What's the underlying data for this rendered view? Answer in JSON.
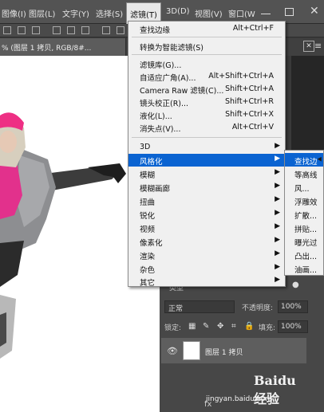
{
  "menubar": {
    "items": [
      {
        "label": "图像(I)",
        "active": false
      },
      {
        "label": "图层(L)",
        "active": false
      },
      {
        "label": "文字(Y)",
        "active": false
      },
      {
        "label": "选择(S)",
        "active": false
      },
      {
        "label": "滤镜(T)",
        "active": true
      },
      {
        "label": "3D(D)",
        "active": false
      },
      {
        "label": "视图(V)",
        "active": false
      },
      {
        "label": "窗口(W",
        "active": false
      }
    ]
  },
  "document_tab": {
    "label": "% (图层 1 拷贝, RGB/8#..."
  },
  "filter_menu": {
    "items": [
      {
        "label": "查找边缘",
        "shortcut": "Alt+Ctrl+F",
        "submenu": false
      },
      {
        "separator": true
      },
      {
        "label": "转换为智能滤镜(S)",
        "shortcut": "",
        "submenu": false
      },
      {
        "separator": true
      },
      {
        "label": "滤镜库(G)...",
        "shortcut": "",
        "submenu": false
      },
      {
        "label": "自适应广角(A)...",
        "shortcut": "Alt+Shift+Ctrl+A",
        "submenu": false
      },
      {
        "label": "Camera Raw 滤镜(C)...",
        "shortcut": "Shift+Ctrl+A",
        "submenu": false
      },
      {
        "label": "镜头校正(R)...",
        "shortcut": "Shift+Ctrl+R",
        "submenu": false
      },
      {
        "label": "液化(L)...",
        "shortcut": "Shift+Ctrl+X",
        "submenu": false
      },
      {
        "label": "消失点(V)...",
        "shortcut": "Alt+Ctrl+V",
        "submenu": false
      },
      {
        "separator": true
      },
      {
        "label": "3D",
        "shortcut": "",
        "submenu": true
      },
      {
        "label": "风格化",
        "shortcut": "",
        "submenu": true,
        "highlighted": true
      },
      {
        "label": "模糊",
        "shortcut": "",
        "submenu": true
      },
      {
        "label": "模糊画廊",
        "shortcut": "",
        "submenu": true
      },
      {
        "label": "扭曲",
        "shortcut": "",
        "submenu": true
      },
      {
        "label": "锐化",
        "shortcut": "",
        "submenu": true
      },
      {
        "label": "视频",
        "shortcut": "",
        "submenu": true
      },
      {
        "label": "像素化",
        "shortcut": "",
        "submenu": true
      },
      {
        "label": "渲染",
        "shortcut": "",
        "submenu": true
      },
      {
        "label": "杂色",
        "shortcut": "",
        "submenu": true
      },
      {
        "label": "其它",
        "shortcut": "",
        "submenu": true
      }
    ]
  },
  "stylize_submenu": {
    "items": [
      {
        "label": "查找边",
        "highlighted": true
      },
      {
        "label": "等高线"
      },
      {
        "label": "风..."
      },
      {
        "label": "浮雕效"
      },
      {
        "label": "扩散..."
      },
      {
        "label": "拼贴..."
      },
      {
        "label": "曝光过"
      },
      {
        "label": "凸出..."
      },
      {
        "label": "油画..."
      }
    ]
  },
  "layers_panel": {
    "kind_label": "类型",
    "blend_mode": "正常",
    "opacity_label": "不透明度:",
    "opacity_value": "100%",
    "lock_label": "锁定:",
    "fill_label": "填充:",
    "fill_value": "100%",
    "layer_name": "图层 1 拷贝",
    "bottom_icons": "fx"
  },
  "watermark": {
    "logo": "Baidu 经验",
    "url": "jingyan.baidu.com"
  },
  "colors": {
    "menu_highlight": "#0a63d1",
    "menu_bg": "#f0f0f0",
    "panel_bg": "#474747",
    "menubar_bg": "#535353"
  }
}
